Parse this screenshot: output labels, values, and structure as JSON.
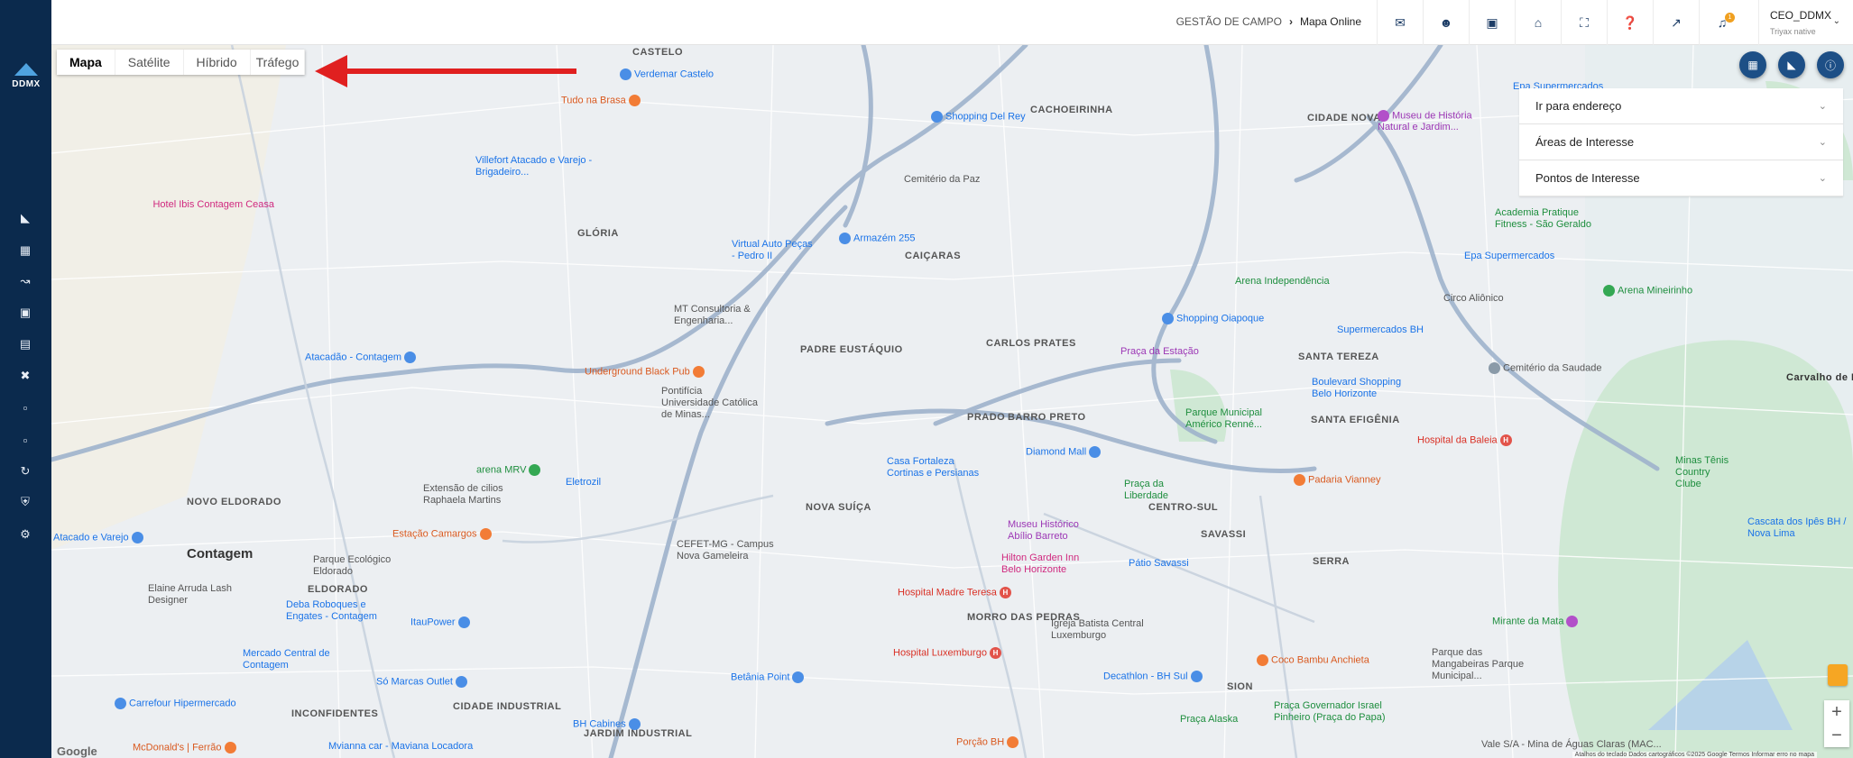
{
  "brand": {
    "logo_text": "DDMX"
  },
  "sidebar": {
    "icons": [
      "car-icon",
      "id-card-icon",
      "chart-line-icon",
      "building-icon",
      "file-icon",
      "tools-icon",
      "document-icon",
      "document-alt-icon",
      "route-icon",
      "shield-icon",
      "settings-icon"
    ]
  },
  "header": {
    "breadcrumb_parent": "GESTÃO DE CAMPO",
    "breadcrumb_current": "Mapa Online",
    "icons": [
      "chat-icon",
      "users-icon",
      "camera-icon",
      "home-icon",
      "fullscreen-icon",
      "help-icon",
      "external-link-icon",
      "bell-icon"
    ],
    "notification_count": "1",
    "user_name": "CEO_DDMX",
    "user_org": "Triyax native"
  },
  "map": {
    "type_buttons": [
      "Mapa",
      "Satélite",
      "Híbrido",
      "Tráfego"
    ],
    "active_type": "Mapa",
    "neighborhoods": [
      {
        "t": "CASTELO"
      },
      {
        "t": "CACHOEIRINHA"
      },
      {
        "t": "CIDADE NOVA"
      },
      {
        "t": "GLÓRIA"
      },
      {
        "t": "CAIÇARAS"
      },
      {
        "t": "CARLOS PRATES"
      },
      {
        "t": "SANTA TEREZA"
      },
      {
        "t": "PADRE EUSTÁQUIO"
      },
      {
        "t": "PRADO"
      },
      {
        "t": "BARRO PRETO"
      },
      {
        "t": "SANTA EFIGÊNIA"
      },
      {
        "t": "NOVO ELDORADO"
      },
      {
        "t": "Contagem"
      },
      {
        "t": "NOVA SUÍÇA"
      },
      {
        "t": "CENTRO-SUL"
      },
      {
        "t": "SAVASSI"
      },
      {
        "t": "SERRA"
      },
      {
        "t": "ELDORADO"
      },
      {
        "t": "MORRO DAS PEDRAS"
      },
      {
        "t": "SION"
      },
      {
        "t": "INCONFIDENTES"
      },
      {
        "t": "CIDADE INDUSTRIAL"
      },
      {
        "t": "JARDIM INDUSTRIAL"
      },
      {
        "t": "Carvalho de Brito"
      }
    ],
    "pois": [
      {
        "t": "Verdemar Castelo"
      },
      {
        "t": "Tudo na Brasa"
      },
      {
        "t": "Shopping Del Rey"
      },
      {
        "t": "Museu de História Natural e Jardim..."
      },
      {
        "t": "Epa Supermercados"
      },
      {
        "t": "Villefort Atacado e Varejo - Brigadeiro..."
      },
      {
        "t": "Cemitério da Paz"
      },
      {
        "t": "Hotel Ibis Contagem Ceasa"
      },
      {
        "t": "Virtual Auto Peças - Pedro II"
      },
      {
        "t": "Armazém 255"
      },
      {
        "t": "Academia Pratique Fitness - São Geraldo"
      },
      {
        "t": "Epa Supermercados"
      },
      {
        "t": "Arena Independência"
      },
      {
        "t": "Circo Aliônico"
      },
      {
        "t": "Arena Mineirinho"
      },
      {
        "t": "MT Consultoria & Engenharia..."
      },
      {
        "t": "Shopping Oiapoque"
      },
      {
        "t": "Supermercados BH"
      },
      {
        "t": "Praça da Estação"
      },
      {
        "t": "Atacadão - Contagem"
      },
      {
        "t": "Underground Black Pub"
      },
      {
        "t": "Pontifícia Universidade Católica de Minas..."
      },
      {
        "t": "Boulevard Shopping Belo Horizonte"
      },
      {
        "t": "Cemitério da Saudade"
      },
      {
        "t": "Parque Municipal Américo Renné..."
      },
      {
        "t": "Diamond Mall"
      },
      {
        "t": "Hospital da Baleia"
      },
      {
        "t": "arena MRV"
      },
      {
        "t": "Eletrozil"
      },
      {
        "t": "Casa Fortaleza Cortinas e Persianas"
      },
      {
        "t": "Praça da Liberdade"
      },
      {
        "t": "Padaria Vianney"
      },
      {
        "t": "Minas Tênis Country Clube"
      },
      {
        "t": "Extensão de cilios Raphaela Martins"
      },
      {
        "t": "Estação Camargos"
      },
      {
        "t": "Museu Histórico Abílio Barreto"
      },
      {
        "t": "Cascata dos Ipês BH / Nova Lima"
      },
      {
        "t": "CEFET-MG - Campus Nova Gameleira"
      },
      {
        "t": "Hilton Garden Inn Belo Horizonte"
      },
      {
        "t": "Pátio Savassi"
      },
      {
        "t": "Parque Ecológico Eldorado"
      },
      {
        "t": "Elaine Arruda Lash Designer"
      },
      {
        "t": "Deba Roboques e Engates - Contagem"
      },
      {
        "t": "ItauPower"
      },
      {
        "t": "Hospital Madre Teresa"
      },
      {
        "t": "Igreja Batista Central Luxemburgo"
      },
      {
        "t": "Mirante da Mata"
      },
      {
        "t": "Mercado Central de Contagem"
      },
      {
        "t": "Hospital Luxemburgo"
      },
      {
        "t": "Coco Bambu Anchieta"
      },
      {
        "t": "Parque das Mangabeiras Parque Municipal..."
      },
      {
        "t": "Só Marcas Outlet"
      },
      {
        "t": "Betânia Point"
      },
      {
        "t": "Decathlon - BH Sul"
      },
      {
        "t": "Carrefour Hipermercado"
      },
      {
        "t": "BH Cabines"
      },
      {
        "t": "Praça Alaska"
      },
      {
        "t": "Praça Governador Israel Pinheiro (Praça do Papa)"
      },
      {
        "t": "McDonald's | Ferrão"
      },
      {
        "t": "Mvianna car - Maviana Locadora"
      },
      {
        "t": "Porção BH"
      },
      {
        "t": "Vale S/A - Mina de Águas Claras (MAC..."
      },
      {
        "t": "Atacado e Varejo"
      }
    ],
    "google_label": "Google",
    "attribution": "Atalhos do teclado   Dados cartográficos ©2025 Google   Termos   Informar erro no mapa"
  },
  "panel": {
    "items": [
      {
        "label": "Ir para endereço"
      },
      {
        "label": "Áreas de Interesse"
      },
      {
        "label": "Pontos de Interesse"
      }
    ]
  },
  "colors": {
    "sidebar": "#0b2a4d",
    "accent": "#1d4f86",
    "arrow": "#e02020",
    "road": "#9fb3cc",
    "park": "#cfe8d4"
  }
}
